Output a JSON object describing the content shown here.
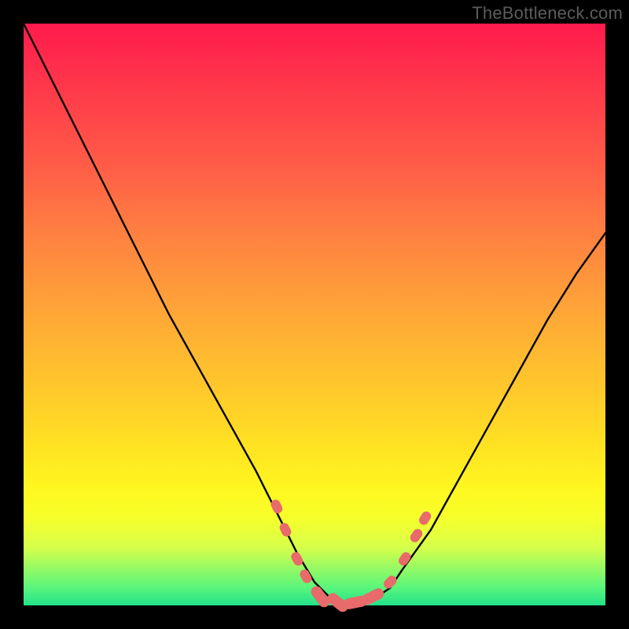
{
  "watermark": "TheBottleneck.com",
  "colors": {
    "background": "#000000",
    "gradient_top": "#ff1a4d",
    "gradient_mid": "#ffe322",
    "gradient_bottom": "#22e28a",
    "curve": "#000000",
    "markers": "#e86a6a"
  },
  "chart_data": {
    "type": "line",
    "title": "",
    "xlabel": "",
    "ylabel": "",
    "xlim": [
      0,
      100
    ],
    "ylim": [
      0,
      100
    ],
    "grid": false,
    "series": [
      {
        "name": "curve",
        "x": [
          0,
          5,
          10,
          15,
          20,
          25,
          30,
          35,
          40,
          45,
          47,
          50,
          53,
          55,
          57,
          60,
          63,
          65,
          70,
          75,
          80,
          85,
          90,
          95,
          100
        ],
        "values": [
          100,
          90,
          80,
          70,
          60,
          50,
          41,
          32,
          23,
          13,
          9,
          4,
          1,
          0,
          0,
          1,
          3,
          6,
          13,
          22,
          31,
          40,
          49,
          57,
          64
        ]
      }
    ],
    "markers": [
      {
        "x": 43.5,
        "y": 17,
        "r": 1.6
      },
      {
        "x": 45.0,
        "y": 13,
        "r": 1.6
      },
      {
        "x": 47.0,
        "y": 8,
        "r": 1.6
      },
      {
        "x": 48.5,
        "y": 5,
        "r": 1.6
      },
      {
        "x": 51.0,
        "y": 1.5,
        "r": 3.0
      },
      {
        "x": 54.0,
        "y": 0.5,
        "r": 3.0
      },
      {
        "x": 57.0,
        "y": 0.5,
        "r": 3.0
      },
      {
        "x": 60.0,
        "y": 1.5,
        "r": 3.0
      },
      {
        "x": 63.0,
        "y": 4,
        "r": 1.6
      },
      {
        "x": 65.5,
        "y": 8,
        "r": 1.6
      },
      {
        "x": 67.5,
        "y": 12,
        "r": 1.6
      },
      {
        "x": 69.0,
        "y": 15,
        "r": 1.6
      }
    ]
  }
}
